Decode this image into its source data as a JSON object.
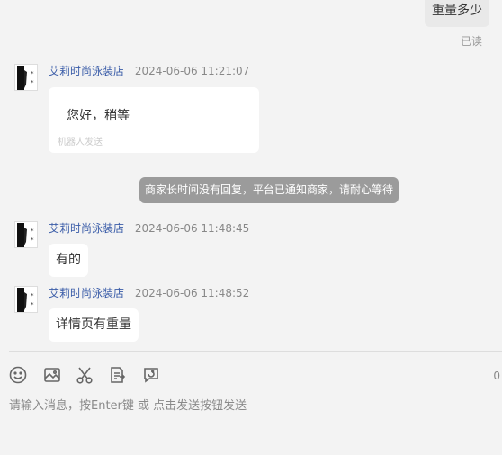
{
  "customer_message": {
    "text": "重量多少",
    "status": "已读"
  },
  "messages": [
    {
      "shop": "艾莉时尚泳装店",
      "time": "2024-06-06 11:21:07",
      "text": "您好，稍等",
      "note": "机器人发送"
    },
    {
      "shop": "艾莉时尚泳装店",
      "time": "2024-06-06 11:48:45",
      "text": "有的"
    },
    {
      "shop": "艾莉时尚泳装店",
      "time": "2024-06-06 11:48:52",
      "text": "详情页有重量"
    }
  ],
  "system_notice": "商家长时间没有回复，平台已通知商家，请耐心等待",
  "toolbar": {
    "icons": [
      "emoji-icon",
      "image-icon",
      "scissors-icon",
      "order-icon",
      "refresh-chat-icon"
    ],
    "char_count": "0"
  },
  "input": {
    "placeholder": "请输入消息，按Enter键 或 点击发送按钮发送"
  }
}
